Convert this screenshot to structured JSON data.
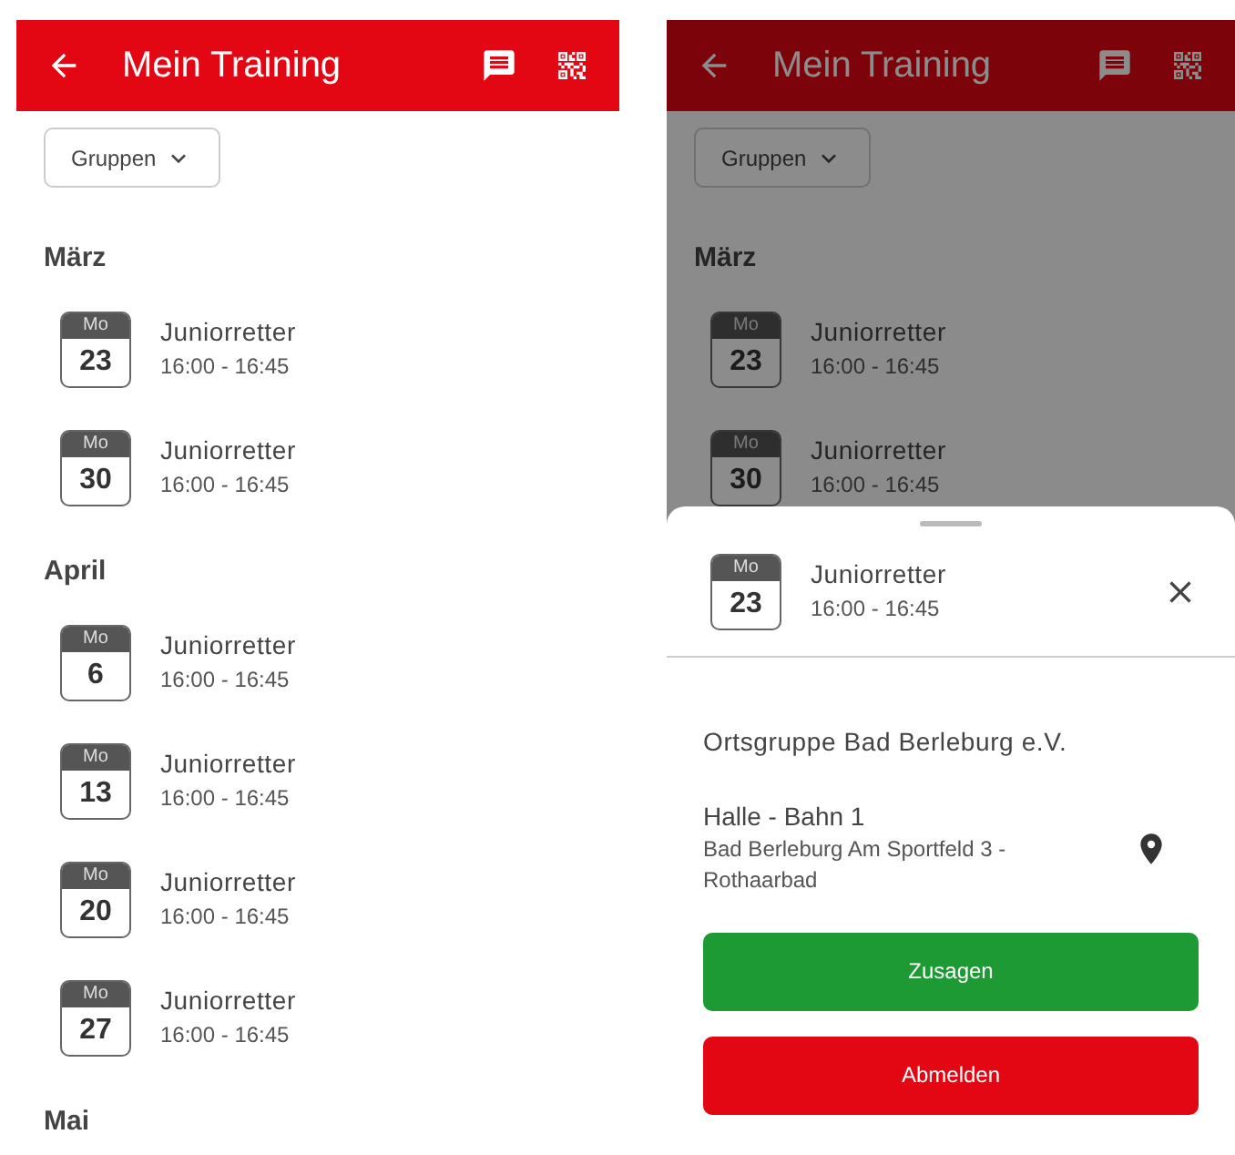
{
  "screens": [
    {
      "dimmed": false,
      "header": {
        "title": "Mein Training"
      },
      "filter": {
        "label": "Gruppen"
      },
      "months": [
        {
          "name": "März",
          "events": [
            {
              "weekday": "Mo",
              "day": "23",
              "title": "Juniorretter",
              "time": "16:00 - 16:45"
            },
            {
              "weekday": "Mo",
              "day": "30",
              "title": "Juniorretter",
              "time": "16:00 - 16:45"
            }
          ]
        },
        {
          "name": "April",
          "events": [
            {
              "weekday": "Mo",
              "day": "6",
              "title": "Juniorretter",
              "time": "16:00 - 16:45"
            },
            {
              "weekday": "Mo",
              "day": "13",
              "title": "Juniorretter",
              "time": "16:00 - 16:45"
            },
            {
              "weekday": "Mo",
              "day": "20",
              "title": "Juniorretter",
              "time": "16:00 - 16:45"
            },
            {
              "weekday": "Mo",
              "day": "27",
              "title": "Juniorretter",
              "time": "16:00 - 16:45"
            }
          ]
        },
        {
          "name": "Mai"
        }
      ]
    },
    {
      "dimmed": true,
      "header": {
        "title": "Mein Training"
      },
      "filter": {
        "label": "Gruppen"
      },
      "months": [
        {
          "name": "März",
          "events": [
            {
              "weekday": "Mo",
              "day": "23",
              "title": "Juniorretter",
              "time": "16:00 - 16:45"
            },
            {
              "weekday": "Mo",
              "day": "30",
              "title": "Juniorretter",
              "time": "16:00 - 16:45"
            }
          ]
        }
      ],
      "sheet": {
        "event": {
          "weekday": "Mo",
          "day": "23",
          "title": "Juniorretter",
          "time": "16:00 - 16:45"
        },
        "organization": "Ortsgruppe Bad Berleburg e.V.",
        "location": {
          "name": "Halle - Bahn 1",
          "address": "Bad Berleburg Am Sportfeld 3 - Rothaarbad"
        },
        "buttons": [
          {
            "label": "Zusagen",
            "kind": "accept"
          },
          {
            "label": "Abmelden",
            "kind": "decline"
          }
        ]
      }
    }
  ]
}
